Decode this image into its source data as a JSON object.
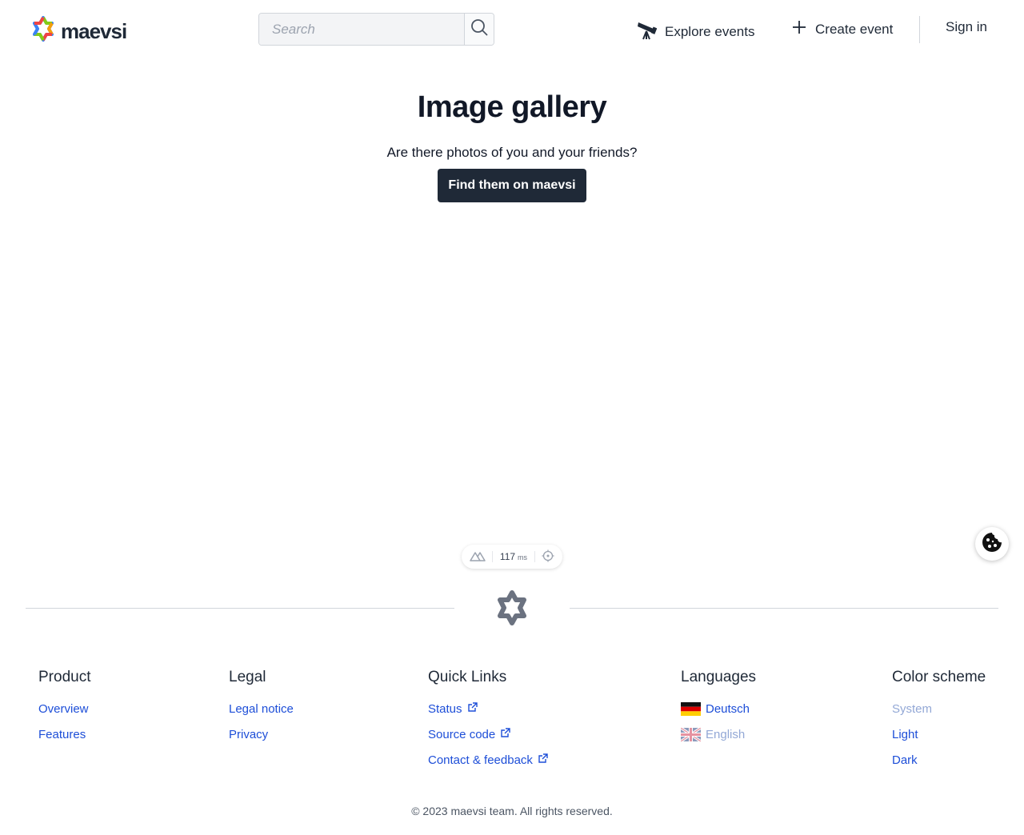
{
  "header": {
    "logo_text": "maevsi",
    "search_placeholder": "Search",
    "nav": {
      "explore_label": "Explore events",
      "create_label": "Create event",
      "signin_label": "Sign in"
    }
  },
  "hero": {
    "title": "Image gallery",
    "subtitle": "Are there photos of you and your friends?",
    "cta_label": "Find them on maevsi"
  },
  "devtools": {
    "time_value": "117",
    "time_unit": "ms"
  },
  "footer": {
    "product": {
      "heading": "Product",
      "links": [
        "Overview",
        "Features"
      ]
    },
    "legal": {
      "heading": "Legal",
      "links": [
        "Legal notice",
        "Privacy"
      ]
    },
    "quick_links": {
      "heading": "Quick Links",
      "links": [
        "Status",
        "Source code",
        "Contact & feedback"
      ]
    },
    "languages": {
      "heading": "Languages",
      "items": [
        {
          "label": "Deutsch",
          "flag": "german-flag-icon"
        },
        {
          "label": "English",
          "flag": "uk-flag-icon",
          "current": true
        }
      ]
    },
    "color_scheme": {
      "heading": "Color scheme",
      "items": [
        {
          "label": "System",
          "current": true
        },
        {
          "label": "Light"
        },
        {
          "label": "Dark"
        }
      ]
    },
    "copyright": "© 2023 maevsi team. All rights reserved."
  },
  "colors": {
    "primary_button": "#1f2937",
    "link": "#1d4ed8",
    "link_muted": "#93a8d6",
    "logo_red": "#ef4444",
    "logo_green": "#84cc16",
    "logo_blue": "#3b82f6",
    "logo_orange": "#f59e0b"
  }
}
